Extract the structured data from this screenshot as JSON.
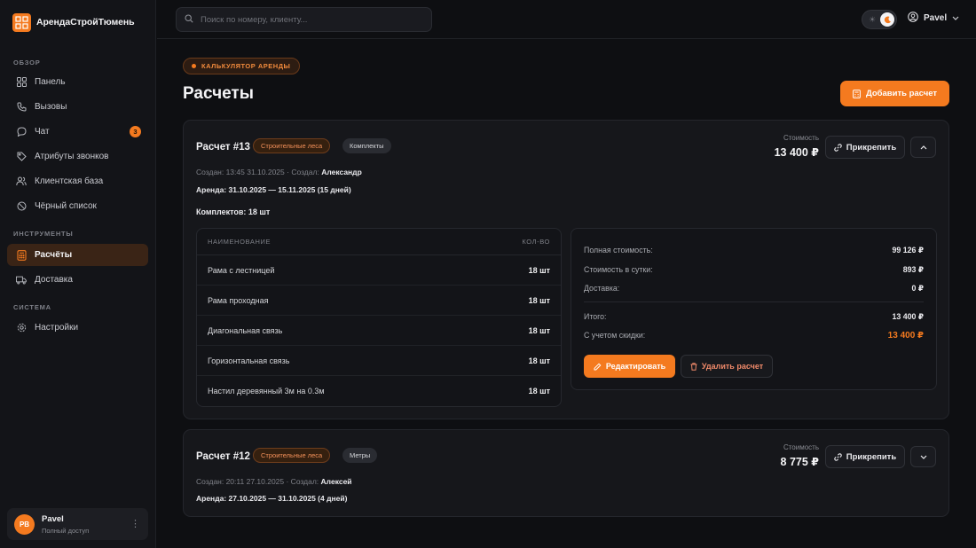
{
  "app": {
    "brand": "АрендаСтройТюмень"
  },
  "sidebar": {
    "sections": [
      {
        "label": "ОБЗОР"
      },
      {
        "label": "ИНСТРУМЕНТЫ"
      },
      {
        "label": "СИСТЕМА"
      }
    ],
    "items": [
      {
        "label": "Панель",
        "icon": "grid-icon"
      },
      {
        "label": "Вызовы",
        "icon": "phone-icon"
      },
      {
        "label": "Чат",
        "icon": "chat-icon",
        "badge": "3"
      },
      {
        "label": "Атрибуты звонков",
        "icon": "tag-icon"
      },
      {
        "label": "Клиентская база",
        "icon": "users-icon"
      },
      {
        "label": "Чёрный список",
        "icon": "ban-icon"
      },
      {
        "label": "Расчёты",
        "icon": "calculator-icon",
        "active": true
      },
      {
        "label": "Доставка",
        "icon": "truck-icon"
      },
      {
        "label": "Настройки",
        "icon": "gear-icon"
      }
    ],
    "user": {
      "initials": "PB",
      "name": "Pavel",
      "role": "Полный доступ"
    }
  },
  "topbar": {
    "search_placeholder": "Поиск по номеру, клиенту...",
    "username": "Pavel"
  },
  "page": {
    "tag": "КАЛЬКУЛЯТОР АРЕНДЫ",
    "title": "Расчеты",
    "add_button": "Добавить расчет"
  },
  "calculations": [
    {
      "title": "Расчет #13",
      "tags": [
        "Строительные леса",
        "Комплекты"
      ],
      "created_prefix": "Создан: 13:45 31.10.2025 · Создал:",
      "author": "Александр",
      "rental": "Аренда: 31.10.2025 — 15.11.2025 (15 дней)",
      "kits": "Комплектов: 18 шт",
      "cost_label": "Стоимость",
      "cost": "13 400 ₽",
      "pin_label": "Прикрепить",
      "table": {
        "headers": [
          "НАИМЕНОВАНИЕ",
          "КОЛ-ВО"
        ],
        "rows": [
          [
            "Рама с лестницей",
            "18 шт"
          ],
          [
            "Рама проходная",
            "18 шт"
          ],
          [
            "Диагональная связь",
            "18 шт"
          ],
          [
            "Горизонтальная связь",
            "18 шт"
          ],
          [
            "Настил деревянный 3м на 0.3м",
            "18 шт"
          ]
        ]
      },
      "summary": {
        "full_cost_label": "Полная стоимость:",
        "full_cost": "99 126 ₽",
        "per_day_label": "Стоимость в сутки:",
        "per_day": "893 ₽",
        "delivery_label": "Доставка:",
        "delivery": "0 ₽",
        "total_label": "Итого:",
        "total": "13 400 ₽",
        "discount_label": "С учетом скидки:",
        "discount": "13 400 ₽"
      },
      "edit_label": "Редактировать",
      "delete_label": "Удалить расчет"
    },
    {
      "title": "Расчет #12",
      "tags": [
        "Строительные леса",
        "Метры"
      ],
      "created_prefix": "Создан: 20:11 27.10.2025 · Создал:",
      "author": "Алексей",
      "rental": "Аренда: 27.10.2025 — 31.10.2025 (4 дней)",
      "cost_label": "Стоимость",
      "cost": "8 775 ₽",
      "pin_label": "Прикрепить"
    }
  ],
  "colors": {
    "accent": "#f47a1f",
    "background": "#0e0f12",
    "card": "#16171b"
  }
}
